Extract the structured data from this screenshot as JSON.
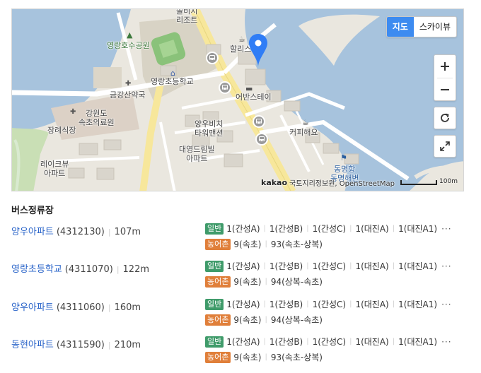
{
  "map": {
    "labels": {
      "resort": "쏠비치\n리조트",
      "lake_park": "영랑호수공원",
      "school": "영랑초등학교",
      "pharmacy": "금강산약국",
      "hospital": "강원도\n속초의료원",
      "funeral": "장례식장",
      "lakeview": "레이크뷰\n아파트",
      "hollys": "할리스",
      "urban_stay": "어반스테이",
      "mansion": "양우비치\n타워맨션",
      "dream": "대영드림빌\n아파트",
      "coffee": "커피해요",
      "port": "동명항\n동명해변"
    },
    "map_type": {
      "map": "지도",
      "skyview": "스카이뷰",
      "active": "map"
    },
    "zoom_in": "+",
    "zoom_out": "−",
    "kakao": "kakao",
    "attribution": "국토지리정보원, OpenStreetMap",
    "scale": "100m",
    "icons": [
      "bus-stop-icon",
      "location-pin-icon",
      "refresh-icon",
      "fullscreen-icon",
      "cafe-icon",
      "hotel-icon",
      "hospital-icon",
      "pharmacy-icon",
      "school-icon",
      "flag-icon"
    ]
  },
  "section_title": "버스정류장",
  "stops": [
    {
      "name": "양우아파트",
      "id": "(4312130)",
      "distance": "107m",
      "general_label": "일반",
      "general_routes": [
        "1(간성A)",
        "1(간성B)",
        "1(간성C)",
        "1(대진A)",
        "1(대진A1)"
      ],
      "rural_label": "농어촌",
      "rural_routes": [
        "9(속초)",
        "93(속초-상복)"
      ]
    },
    {
      "name": "영랑초등학교",
      "id": "(4311070)",
      "distance": "122m",
      "general_label": "일반",
      "general_routes": [
        "1(간성A)",
        "1(간성B)",
        "1(간성C)",
        "1(대진A)",
        "1(대진A1)"
      ],
      "rural_label": "농어촌",
      "rural_routes": [
        "9(속초)",
        "94(상복-속초)"
      ]
    },
    {
      "name": "양우아파트",
      "id": "(4311060)",
      "distance": "160m",
      "general_label": "일반",
      "general_routes": [
        "1(간성A)",
        "1(간성B)",
        "1(간성C)",
        "1(대진A)",
        "1(대진A1)"
      ],
      "rural_label": "농어촌",
      "rural_routes": [
        "9(속초)",
        "94(상복-속초)"
      ]
    },
    {
      "name": "동현아파트",
      "id": "(4311590)",
      "distance": "210m",
      "general_label": "일반",
      "general_routes": [
        "1(간성A)",
        "1(간성B)",
        "1(간성C)",
        "1(대진A)",
        "1(대진A1)"
      ],
      "rural_label": "농어촌",
      "rural_routes": [
        "9(속초)",
        "93(속초-상복)"
      ]
    }
  ],
  "more_label": "···",
  "colors": {
    "link": "#2a64c9",
    "general_badge": "#3f9b6a",
    "rural_badge": "#e07f3a",
    "active_maptype": "#3d8bf0"
  }
}
